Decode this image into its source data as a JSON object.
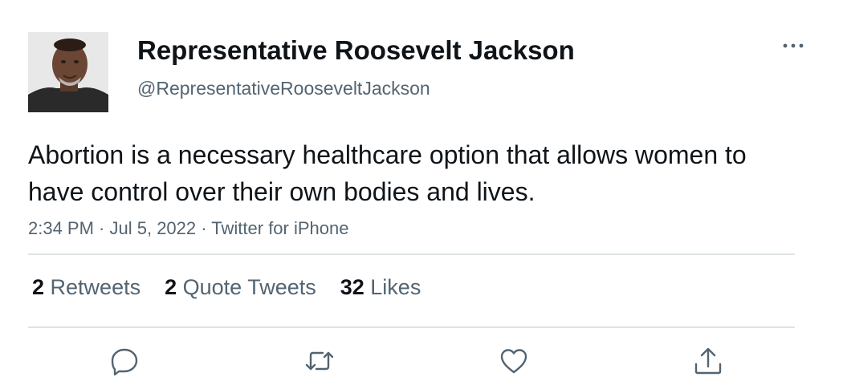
{
  "tweet": {
    "display_name": "Representative Roosevelt Jackson",
    "handle": "@RepresentativeRooseveltJackson",
    "text": "Abortion is a necessary healthcare option that allows women to have control over their own bodies and lives.",
    "time": "2:34 PM",
    "separator": " · ",
    "date": "Jul 5, 2022",
    "source": "Twitter for iPhone"
  },
  "stats": {
    "retweets_count": "2",
    "retweets_label": " Retweets",
    "quotes_count": "2",
    "quotes_label": " Quote Tweets",
    "likes_count": "32",
    "likes_label": " Likes"
  },
  "icons": {
    "more": "more-horizontal-icon",
    "reply": "reply-icon",
    "retweet": "retweet-icon",
    "like": "heart-icon",
    "share": "share-icon"
  },
  "colors": {
    "text_primary": "#0f1419",
    "text_secondary": "#536471",
    "divider": "#dfe3e6",
    "icon": "#536471"
  }
}
